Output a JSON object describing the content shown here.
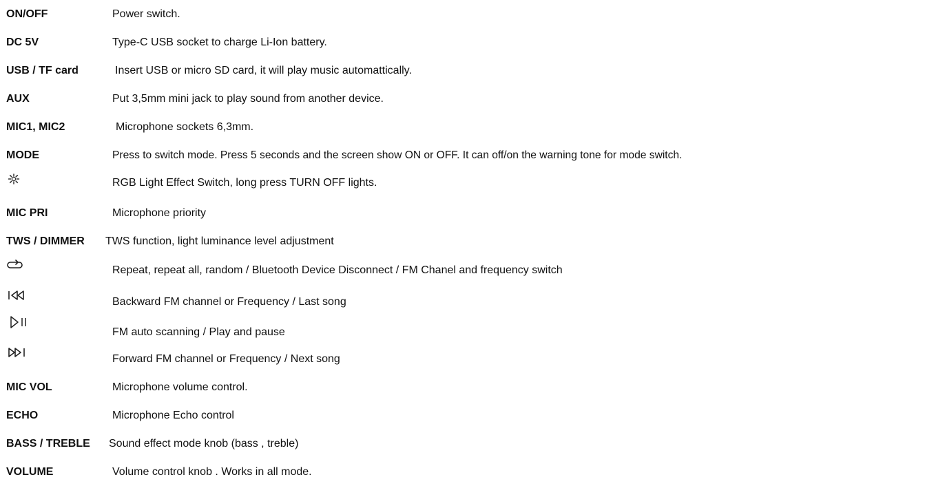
{
  "entries": [
    {
      "term": "ON/OFF",
      "desc": "Power switch."
    },
    {
      "term": "DC 5V",
      "desc": "Type-C USB socket to charge Li-Ion battery."
    },
    {
      "term": "USB / TF card",
      "desc": "Insert USB or micro SD card, it will play music automattically."
    },
    {
      "term": "AUX",
      "desc": "Put 3,5mm mini jack to play sound from another device."
    },
    {
      "term": "MIC1, MIC2",
      "desc": "Microphone sockets 6,3mm."
    },
    {
      "term": "MODE",
      "desc": "Press to switch mode. Press 5 seconds and the screen show ON or OFF. It can off/on the warning tone for mode switch."
    },
    {
      "icon": "light-effect-icon",
      "desc": "RGB Light Effect Switch, long press TURN OFF lights."
    },
    {
      "term": "MIC PRI",
      "desc": "Microphone priority"
    },
    {
      "term": "TWS / DIMMER",
      "desc": "TWS function, light luminance level adjustment"
    },
    {
      "icon": "repeat-icon",
      "desc": "Repeat, repeat all, random / Bluetooth Device Disconnect / FM Chanel and frequency switch"
    },
    {
      "icon": "previous-track-icon",
      "desc": "Backward FM channel or Frequency / Last song"
    },
    {
      "icon": "play-pause-icon",
      "desc": "FM auto scanning / Play and pause"
    },
    {
      "icon": "next-track-icon",
      "desc": "Forward FM channel or Frequency / Next song"
    },
    {
      "term": "MIC VOL",
      "desc": "Microphone volume control."
    },
    {
      "term": "ECHO",
      "desc": "Microphone Echo control"
    },
    {
      "term": "BASS / TREBLE",
      "desc": "Sound effect mode knob (bass , treble)"
    },
    {
      "term": "VOLUME",
      "desc": "Volume control knob . Works in all mode."
    }
  ]
}
